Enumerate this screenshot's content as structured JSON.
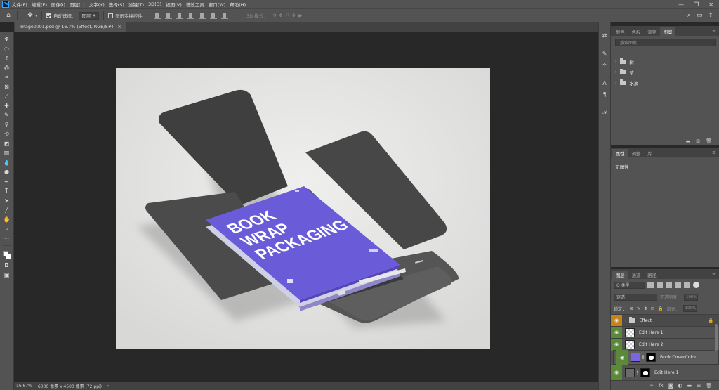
{
  "menu": {
    "logo": "Ps",
    "items": [
      "文件(F)",
      "编辑(E)",
      "图像(I)",
      "图层(L)",
      "文字(Y)",
      "选择(S)",
      "滤镜(T)",
      "3D(D)",
      "视图(V)",
      "增效工具",
      "窗口(W)",
      "帮助(H)"
    ],
    "window_controls": [
      "—",
      "❐",
      "✕"
    ]
  },
  "options": {
    "auto_select_label": "自动选择：",
    "auto_select_value": "图层",
    "show_transform_label": "显示变换控件",
    "mode_3d_label": "3D 模式："
  },
  "document": {
    "tab_title": "Image0001.psd @ 16.7% (Effect, RGB/8#)",
    "tab_close": "×"
  },
  "mockup": {
    "title_line1": "BOOK",
    "title_line2": "WRAP",
    "title_line3": "PACKAGING",
    "colors": {
      "cover": "#6a5bd9",
      "box": "#4a4a4a",
      "backdrop": "#e6e6e5"
    }
  },
  "status": {
    "zoom": "16.67%",
    "doc_info": "6000 像素 x 4500 像素 (72 ppi)",
    "arrow": "›"
  },
  "panel_libraries": {
    "tabs": [
      "颜色",
      "色板",
      "渐变",
      "图案"
    ],
    "active_tab": "图案",
    "search_placeholder": "搜索图案",
    "items": [
      "树",
      "草",
      "水滴"
    ]
  },
  "panel_properties": {
    "tabs": [
      "属性",
      "调整",
      "库"
    ],
    "active_tab": "属性",
    "empty_text": "无属性"
  },
  "panel_layers": {
    "tabs": [
      "图层",
      "通道",
      "路径"
    ],
    "active_tab": "图层",
    "filter_label": "Q 类型",
    "blend_mode": "穿透",
    "opacity_label": "不透明度：",
    "opacity_value": "100%",
    "lock_label": "锁定：",
    "fill_label": "填充：",
    "fill_value": "100%",
    "layers": [
      {
        "name": "Effect"
      },
      {
        "name": "Edit Here 1"
      },
      {
        "name": "Edit Here 2"
      },
      {
        "name": "Book CoverColor"
      },
      {
        "name": "Edit Here 1"
      }
    ]
  }
}
